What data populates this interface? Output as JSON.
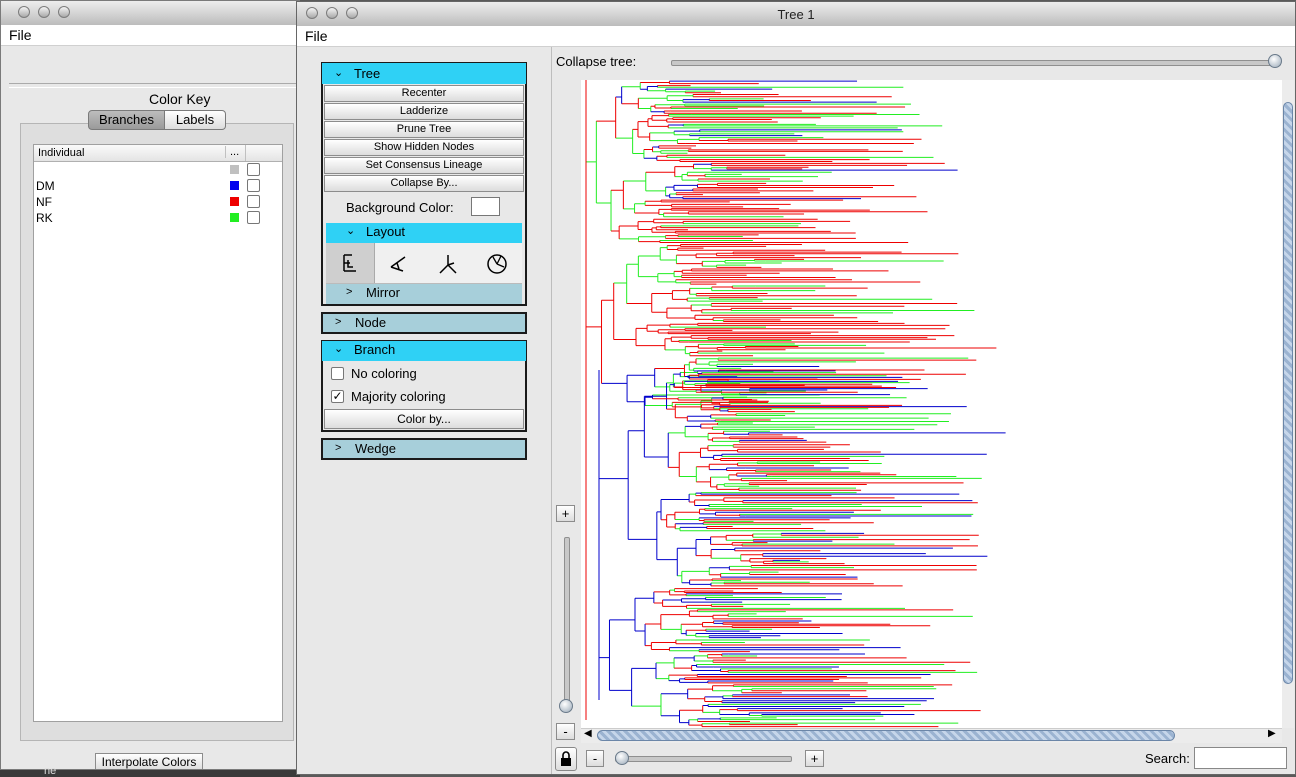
{
  "left_window": {
    "menu": {
      "file": "File"
    },
    "color_key": {
      "title": "Color Key",
      "tabs": [
        {
          "label": "Branches",
          "selected": true
        },
        {
          "label": "Labels",
          "selected": false
        }
      ],
      "table_headers": [
        "Individual",
        "..."
      ],
      "rows": [
        {
          "label": "",
          "color": "#c0c0c0"
        },
        {
          "label": "DM",
          "color": "#0000ee"
        },
        {
          "label": "NF",
          "color": "#ee0000"
        },
        {
          "label": "RK",
          "color": "#22ee22"
        }
      ],
      "interpolate_button": "Interpolate Colors"
    },
    "bottom_fragment": "ne"
  },
  "main_window": {
    "title": "Tree 1",
    "menu": {
      "file": "File"
    },
    "tree_panel": {
      "header": "Tree",
      "buttons": [
        "Recenter",
        "Ladderize",
        "Prune Tree",
        "Show Hidden Nodes",
        "Set Consensus Lineage",
        "Collapse By..."
      ],
      "background_color_label": "Background Color:",
      "layout_header": "Layout",
      "layout_icons": [
        "rectangular-layout-icon",
        "polar-layout-icon",
        "radial-layout-icon",
        "circular-layout-icon"
      ],
      "mirror_header": "Mirror"
    },
    "node_header": "Node",
    "branch_panel": {
      "header": "Branch",
      "no_coloring": {
        "label": "No coloring",
        "checked": false
      },
      "majority_coloring": {
        "label": "Majority coloring",
        "checked": true
      },
      "color_by_button": "Color by..."
    },
    "wedge_header": "Wedge",
    "collapse_tree_label": "Collapse tree:",
    "collapse_tree_value": 1.0,
    "zoom_plus": "+",
    "zoom_minus": "-",
    "hzoom_minus": "-",
    "hzoom_plus": "+",
    "search_label": "Search:",
    "search_value": "",
    "colors": {
      "accent_header": "#2fd1f5",
      "collapsed_header": "#a7cfda",
      "red": "#ee0000",
      "green": "#22ee22",
      "blue": "#0000cc"
    }
  }
}
